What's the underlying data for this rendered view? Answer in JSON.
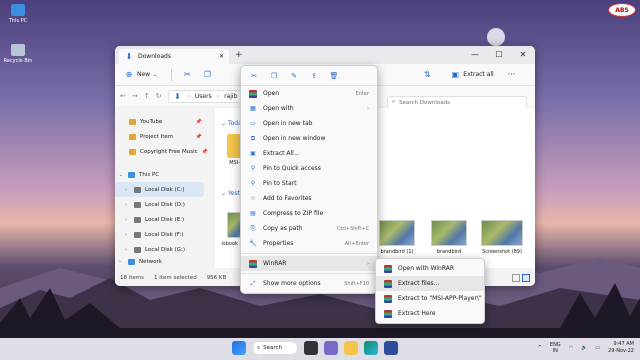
{
  "desktop": {
    "icons": [
      {
        "label": "This PC",
        "color": "#3c8ee0"
      },
      {
        "label": "Recycle Bin",
        "color": "#b7c7d8"
      }
    ],
    "watermark": "ABS"
  },
  "explorer": {
    "tab_title": "Downloads",
    "toolbar": {
      "new_label": "New",
      "extract_all_label": "Extract all"
    },
    "breadcrumb": [
      "Users",
      "rajib"
    ],
    "search_placeholder": "Search Downloads",
    "sidebar": [
      {
        "label": "YouTube",
        "pinned": true,
        "color": "#e0a82e"
      },
      {
        "label": "Project Item",
        "pinned": true,
        "color": "#e0a82e"
      },
      {
        "label": "Copyright Free Music",
        "pinned": true,
        "color": "#e0a82e"
      },
      {
        "label": "This PC",
        "color": "#3c8ee0",
        "expanded": true
      },
      {
        "label": "Local Disk (C:)",
        "color": "#777",
        "selected": true
      },
      {
        "label": "Local Disk (D:)",
        "color": "#777"
      },
      {
        "label": "Local Disk (E:)",
        "color": "#777"
      },
      {
        "label": "Local Disk (F:)",
        "color": "#777"
      },
      {
        "label": "Local Disk (G:)",
        "color": "#777"
      },
      {
        "label": "Network",
        "color": "#3c8ee0"
      }
    ],
    "groups": {
      "today": "Toda",
      "yesterday": "Yeste"
    },
    "items": [
      {
        "label": "MSI-..."
      },
      {
        "label": "isbook 5383"
      },
      {
        "label": "brandbird (1)"
      },
      {
        "label": "brandbird"
      },
      {
        "label": "Screenshot (89)"
      }
    ],
    "status": {
      "count": "18 items",
      "selected": "1 item selected",
      "size": "956 KB"
    }
  },
  "context_menu": {
    "items": [
      {
        "label": "Open",
        "shortcut": "Enter",
        "icon": "open-icon"
      },
      {
        "label": "Open with",
        "submenu": true,
        "icon": "open-with-icon"
      },
      {
        "label": "Open in new tab",
        "icon": "new-tab-icon"
      },
      {
        "label": "Open in new window",
        "icon": "new-window-icon"
      },
      {
        "label": "Extract All...",
        "icon": "extract-icon"
      },
      {
        "label": "Pin to Quick access",
        "icon": "pin-icon"
      },
      {
        "label": "Pin to Start",
        "icon": "pin-icon"
      },
      {
        "label": "Add to Favorites",
        "icon": "star-icon"
      },
      {
        "label": "Compress to ZIP file",
        "icon": "zip-icon"
      },
      {
        "label": "Copy as path",
        "shortcut": "Ctrl+Shift+C",
        "icon": "copy-path-icon"
      },
      {
        "label": "Properties",
        "shortcut": "Alt+Enter",
        "icon": "properties-icon"
      }
    ],
    "winrar": "WinRAR",
    "more": {
      "label": "Show more options",
      "shortcut": "Shift+F10"
    }
  },
  "winrar_submenu": [
    "Open with WinRAR",
    "Extract files...",
    "Extract to \"MSI-APP-Player\\\"",
    "Extract Here"
  ],
  "taskbar": {
    "search_label": "Search",
    "lang_top": "ENG",
    "lang_bottom": "IN",
    "time": "9:47 AM",
    "date": "29-Nov-22"
  }
}
